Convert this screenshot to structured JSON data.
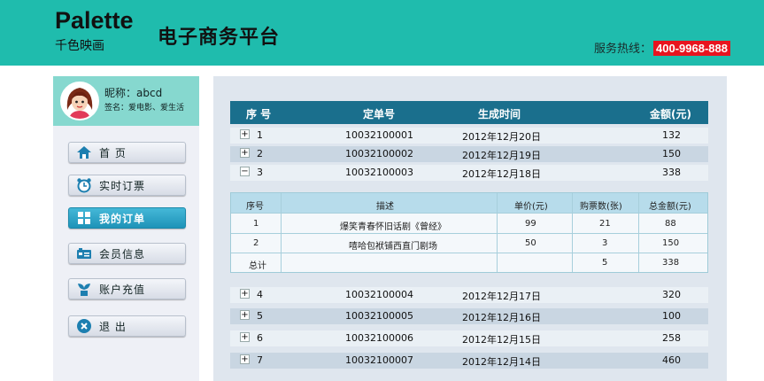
{
  "header": {
    "logo_en": "Palette",
    "logo_cn": "千色映画",
    "platform_title": "电子商务平台",
    "hotline_label": "服务热线：",
    "hotline_number": "400-9968-888",
    "accent_color": "#1fbcad",
    "hotline_color": "#e8141f"
  },
  "profile": {
    "nickname": "昵称：abcd",
    "signature": "签名：爱电影、爱生活"
  },
  "menu": [
    {
      "label": "首 页",
      "icon": "home-icon",
      "active": false
    },
    {
      "label": "实时订票",
      "icon": "alarm-clock-icon",
      "active": false
    },
    {
      "label": "我的订单",
      "icon": "grid-icon",
      "active": true
    },
    {
      "label": "会员信息",
      "icon": "member-card-icon",
      "active": false
    },
    {
      "label": "账户充值",
      "icon": "plant-icon",
      "active": false
    },
    {
      "label": "退 出",
      "icon": "close-circle-icon",
      "active": false
    }
  ],
  "orders": {
    "headers": {
      "seq": "序  号",
      "order_no": "定单号",
      "created": "生成时间",
      "amount": "金额(元)"
    },
    "rows": [
      {
        "toggle": "+",
        "seq": "1",
        "order_no": "10032100001",
        "created": "2012年12月20日",
        "amount": "132"
      },
      {
        "toggle": "+",
        "seq": "2",
        "order_no": "10032100002",
        "created": "2012年12月19日",
        "amount": "150"
      },
      {
        "toggle": "−",
        "seq": "3",
        "order_no": "10032100003",
        "created": "2012年12月18日",
        "amount": "338"
      },
      {
        "toggle": "+",
        "seq": "4",
        "order_no": "10032100004",
        "created": "2012年12月17日",
        "amount": "320"
      },
      {
        "toggle": "+",
        "seq": "5",
        "order_no": "10032100005",
        "created": "2012年12月16日",
        "amount": "100"
      },
      {
        "toggle": "+",
        "seq": "6",
        "order_no": "10032100006",
        "created": "2012年12月15日",
        "amount": "258"
      },
      {
        "toggle": "+",
        "seq": "7",
        "order_no": "10032100007",
        "created": "2012年12月14日",
        "amount": "460"
      }
    ]
  },
  "detail": {
    "headers": {
      "seq": "序号",
      "desc": "描述",
      "price": "单价(元)",
      "qty": "购票数(张)",
      "total": "总金额(元)"
    },
    "items": [
      {
        "seq": "1",
        "desc": "爆笑青春怀旧话剧《曾经》",
        "price": "99",
        "qty": "21",
        "total": "88"
      },
      {
        "seq": "2",
        "desc": "嘻哈包袱铺西直门剧场",
        "price": "50",
        "qty": "3",
        "total": "150"
      }
    ],
    "sum": {
      "label": "总计",
      "qty": "5",
      "total": "338"
    }
  }
}
